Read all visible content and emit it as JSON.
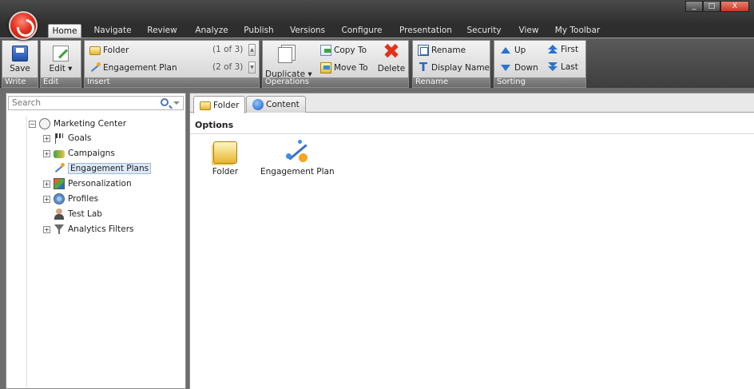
{
  "window": {
    "controls": [
      "_",
      "□",
      "X"
    ]
  },
  "ribbon_tabs": [
    "Home",
    "Navigate",
    "Review",
    "Analyze",
    "Publish",
    "Versions",
    "Configure",
    "Presentation",
    "Security",
    "View",
    "My Toolbar"
  ],
  "active_tab": "Home",
  "ribbon": {
    "write": {
      "label": "Write",
      "save": "Save"
    },
    "edit": {
      "label": "Edit",
      "edit_button": "Edit ▾"
    },
    "insert": {
      "label": "Insert",
      "items": [
        {
          "label": "Folder",
          "count": "(1 of 3)"
        },
        {
          "label": "Engagement Plan",
          "count": "(2 of 3)"
        }
      ]
    },
    "operations": {
      "label": "Operations",
      "duplicate": "Duplicate ▾",
      "copy_to": "Copy To",
      "move_to": "Move To",
      "delete": "Delete"
    },
    "rename": {
      "label": "Rename",
      "rename": "Rename",
      "display_name": "Display Name"
    },
    "sorting": {
      "label": "Sorting",
      "up": "Up",
      "down": "Down",
      "first": "First",
      "last": "Last"
    }
  },
  "search": {
    "placeholder": "Search"
  },
  "tree": {
    "root": "Marketing Center",
    "items": [
      {
        "label": "Goals",
        "expandable": true,
        "icon": "flag-icon"
      },
      {
        "label": "Campaigns",
        "expandable": true,
        "icon": "campaigns-icon"
      },
      {
        "label": "Engagement Plans",
        "expandable": false,
        "icon": "engagement-plan-icon",
        "selected": true
      },
      {
        "label": "Personalization",
        "expandable": true,
        "icon": "personalization-icon"
      },
      {
        "label": "Profiles",
        "expandable": true,
        "icon": "profiles-icon"
      },
      {
        "label": "Test Lab",
        "expandable": false,
        "icon": "test-lab-icon"
      },
      {
        "label": "Analytics Filters",
        "expandable": true,
        "icon": "filter-icon"
      }
    ]
  },
  "content_tabs": [
    {
      "label": "Folder",
      "active": true
    },
    {
      "label": "Content",
      "active": false
    }
  ],
  "options": {
    "title": "Options",
    "items": [
      {
        "label": "Folder"
      },
      {
        "label": "Engagement Plan"
      }
    ]
  }
}
